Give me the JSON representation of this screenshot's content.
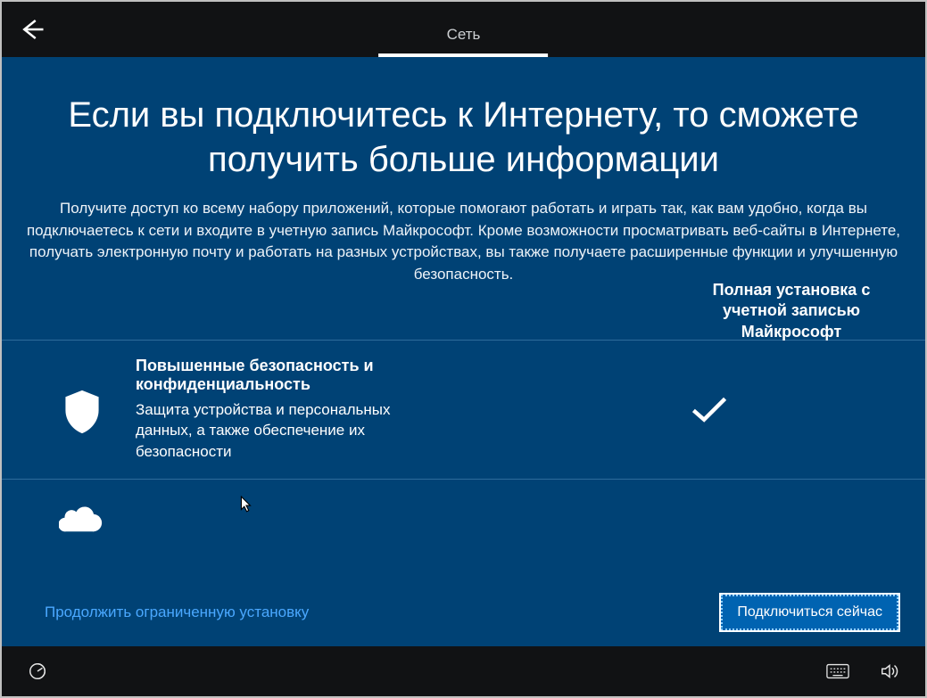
{
  "topbar": {
    "tab_label": "Сеть"
  },
  "headline": "Если вы подключитесь к Интернету, то сможете получить больше информации",
  "subtext": "Получите доступ ко всему набору приложений, которые помогают работать и играть так, как вам удобно, когда вы подключаетесь к сети и входите в учетную запись Майкрософт. Кроме возможности просматривать веб-сайты в Интернете, получать электронную почту и работать на разных устройствах, вы также получаете расширенные функции и улучшенную безопасность.",
  "column_header": "Полная установка с учетной записью Майкрософт",
  "rows": {
    "security": {
      "title": "Повышенные безопасность и конфиденциальность",
      "desc": "Защита устройства и персональных данных, а также обеспечение их безопасности"
    }
  },
  "footer": {
    "limited_link": "Продолжить ограниченную установку",
    "connect_button": "Подключиться сейчас"
  },
  "icons": {
    "back": "back-arrow-icon",
    "shield": "shield-icon",
    "cloud": "cloud-icon",
    "check": "check-icon",
    "ease": "ease-of-access-icon",
    "keyboard": "keyboard-icon",
    "volume": "volume-icon"
  }
}
